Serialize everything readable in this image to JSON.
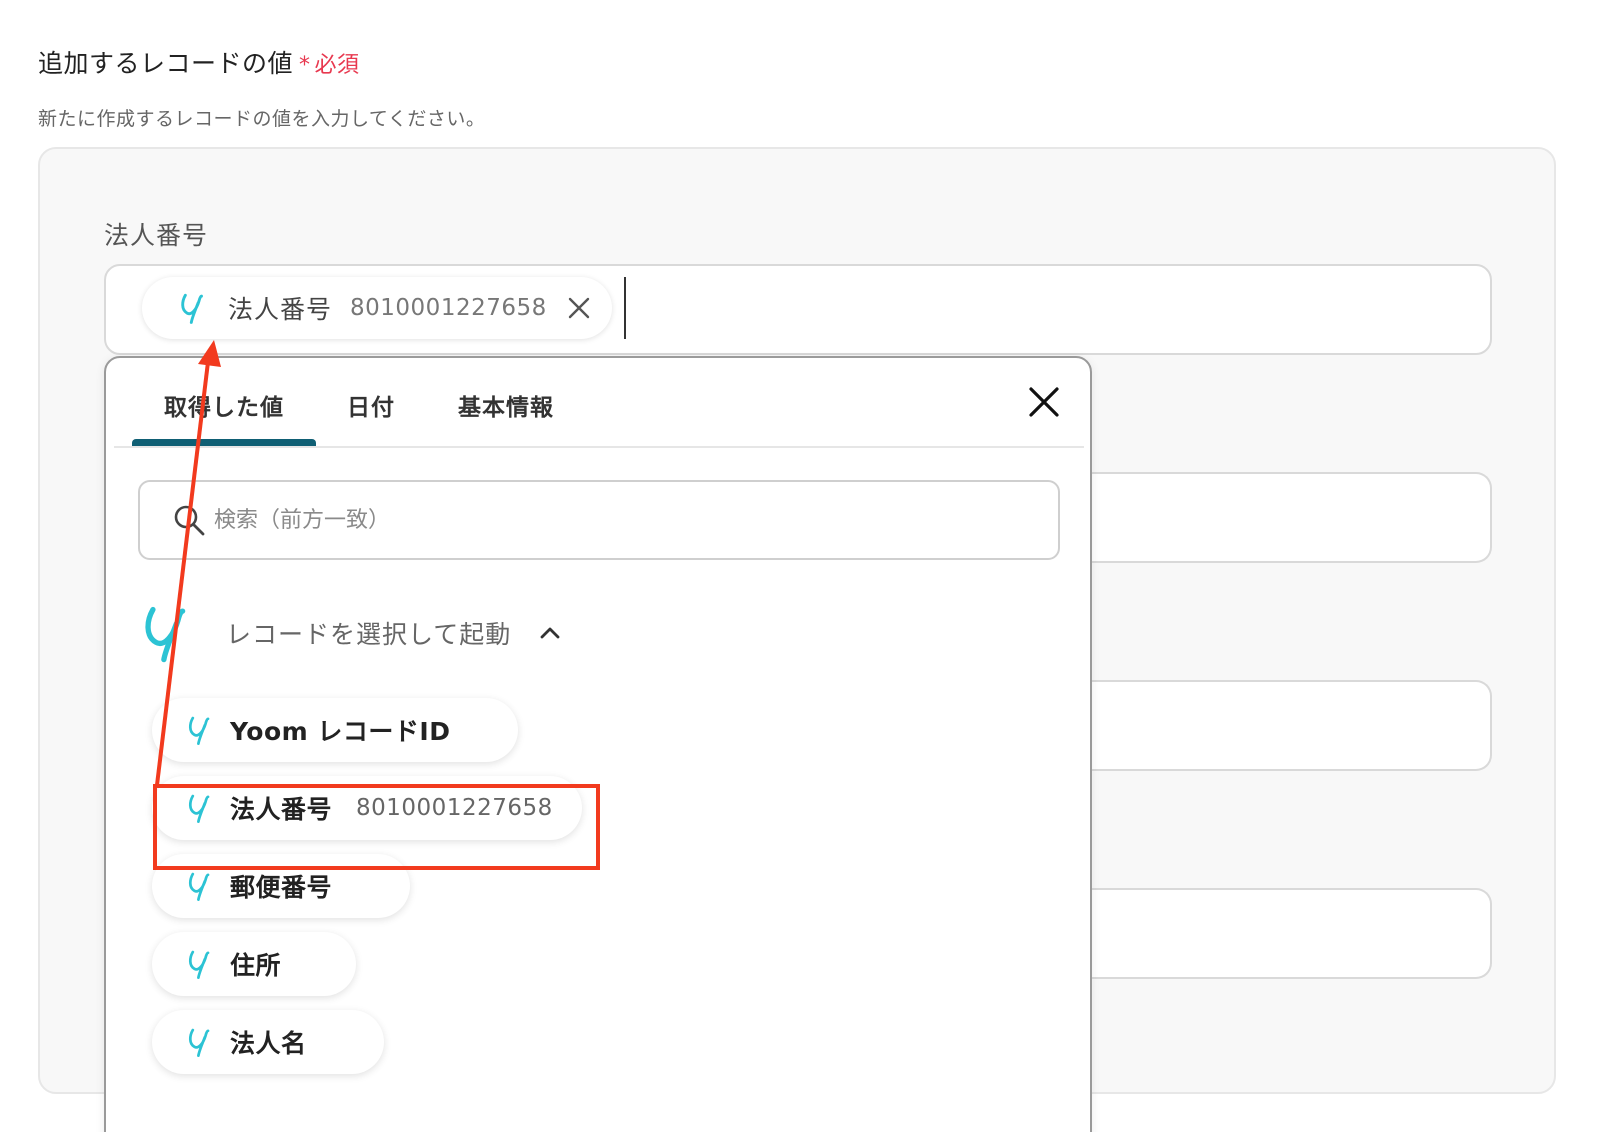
{
  "section": {
    "title": "追加するレコードの値",
    "required_star": "*",
    "required_text": "必須",
    "description": "新たに作成するレコードの値を入力してください。"
  },
  "field": {
    "label": "法人番号",
    "chip": {
      "label": "法人番号",
      "value": "8010001227658"
    }
  },
  "popup": {
    "tabs": [
      {
        "label": "取得した値",
        "active": true
      },
      {
        "label": "日付",
        "active": false
      },
      {
        "label": "基本情報",
        "active": false
      }
    ],
    "search_placeholder": "検索（前方一致）",
    "group_label": "レコードを選択して起動",
    "items": [
      {
        "label": "Yoom レコードID",
        "value": ""
      },
      {
        "label": "法人番号",
        "value": "8010001227658"
      },
      {
        "label": "郵便番号",
        "value": ""
      },
      {
        "label": "住所",
        "value": ""
      },
      {
        "label": "法人名",
        "value": ""
      }
    ]
  },
  "colors": {
    "required": "#e8384f",
    "tab_active_underline": "#0f5f74",
    "annotation": "#f23a1e",
    "brand_icon": "#2cc3d4"
  },
  "icons": {
    "brand": "yoom-y-icon",
    "remove": "close-icon",
    "search": "search-icon",
    "collapse": "chevron-up-icon"
  }
}
